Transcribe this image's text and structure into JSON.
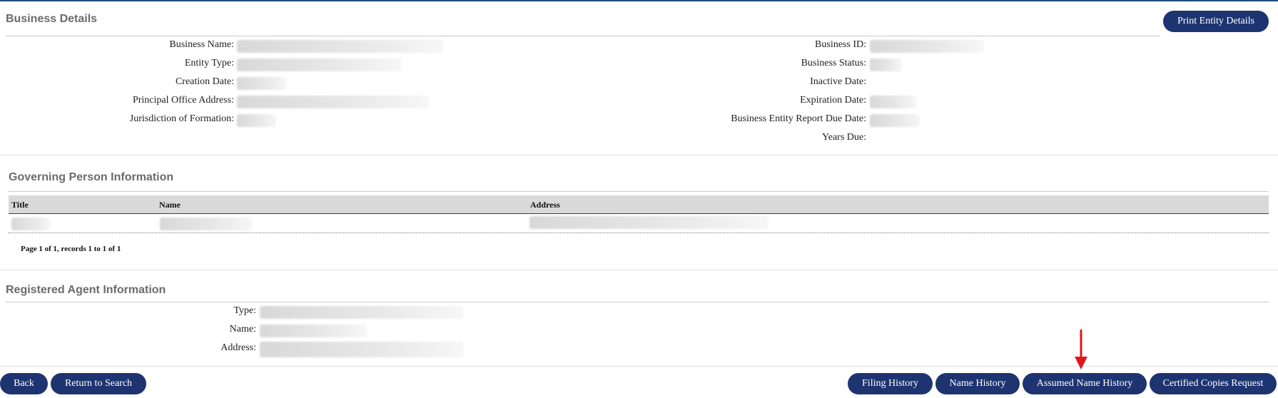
{
  "business_details": {
    "title": "Business Details",
    "print_button": "Print Entity Details",
    "left_labels": [
      "Business Name:",
      "Entity Type:",
      "Creation Date:",
      "Principal Office Address:",
      "Jurisdiction of Formation:"
    ],
    "right_labels": [
      "Business ID:",
      "Business Status:",
      "Inactive Date:",
      "Expiration Date:",
      "Business Entity Report Due Date:",
      "Years Due:"
    ]
  },
  "governing_person": {
    "title": "Governing Person Information",
    "columns": [
      "Title",
      "Name",
      "Address"
    ],
    "pager": "Page 1 of 1, records 1 to 1 of 1"
  },
  "registered_agent": {
    "title": "Registered Agent Information",
    "labels": [
      "Type:",
      "Name:",
      "Address:"
    ]
  },
  "footer": {
    "back": "Back",
    "return_to_search": "Return to Search",
    "filing_history": "Filing History",
    "name_history": "Name History",
    "assumed_name_history": "Assumed Name History",
    "certified_copies_request": "Certified Copies Request"
  },
  "colors": {
    "button": "#1d3470",
    "annotation_arrow": "#e0161e"
  }
}
